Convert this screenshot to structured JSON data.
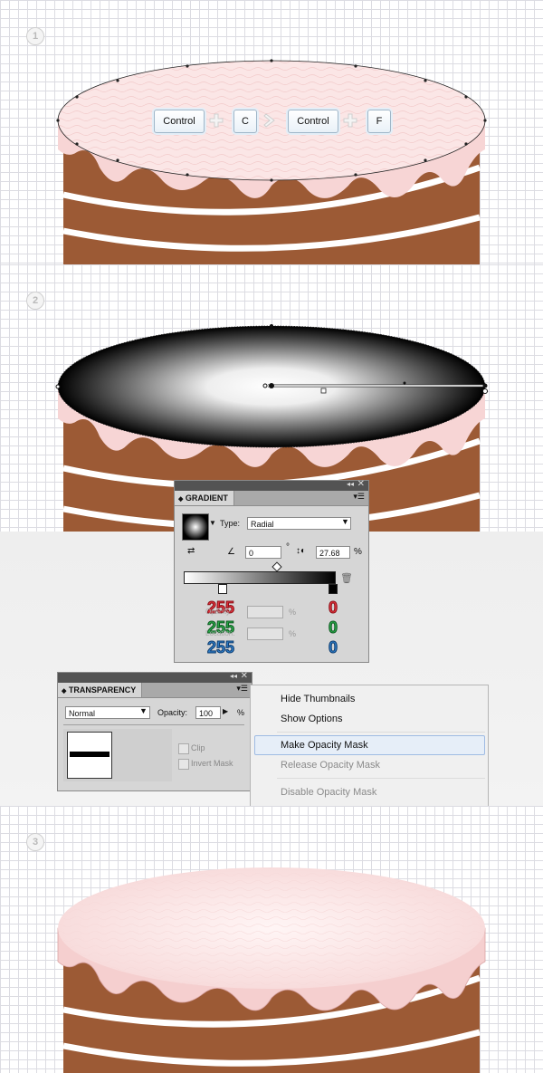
{
  "steps": [
    "1",
    "2",
    "3"
  ],
  "shortcut": {
    "key1": "Control",
    "key2": "C",
    "key3": "Control",
    "key4": "F"
  },
  "gradient_panel": {
    "title": "GRADIENT",
    "type_label": "Type:",
    "type_value": "Radial",
    "angle_value": "0",
    "angle_unit": "°",
    "aspect_value": "27.68",
    "aspect_unit": "%",
    "opacity_unit": "%",
    "location_unit": "%",
    "opacity_ghost": "Opacity:",
    "location_ghost": "Location:"
  },
  "rgb_left": {
    "r": "255",
    "g": "255",
    "b": "255"
  },
  "rgb_right": {
    "r": "0",
    "g": "0",
    "b": "0"
  },
  "transparency_panel": {
    "title": "TRANSPARENCY",
    "blend_mode": "Normal",
    "opacity_label": "Opacity:",
    "opacity_value": "100",
    "opacity_unit": "%",
    "clip_label": "Clip",
    "invert_mask_label": "Invert Mask"
  },
  "menu": {
    "items": [
      "Hide Thumbnails",
      "Show Options",
      "Make Opacity Mask",
      "Release Opacity Mask",
      "Disable Opacity Mask"
    ]
  },
  "colors": {
    "cake": "#9c5a35",
    "frosting": "#fbe6e6",
    "accent_blue": "#2e7bc4",
    "red": "#e0323c",
    "green": "#2aa84a"
  },
  "icons": [
    "plus-icon",
    "chevron-right-icon",
    "trash-icon",
    "swap-icon",
    "angle-icon",
    "aspect-icon",
    "menu-icon",
    "collapse-icon",
    "close-icon"
  ]
}
